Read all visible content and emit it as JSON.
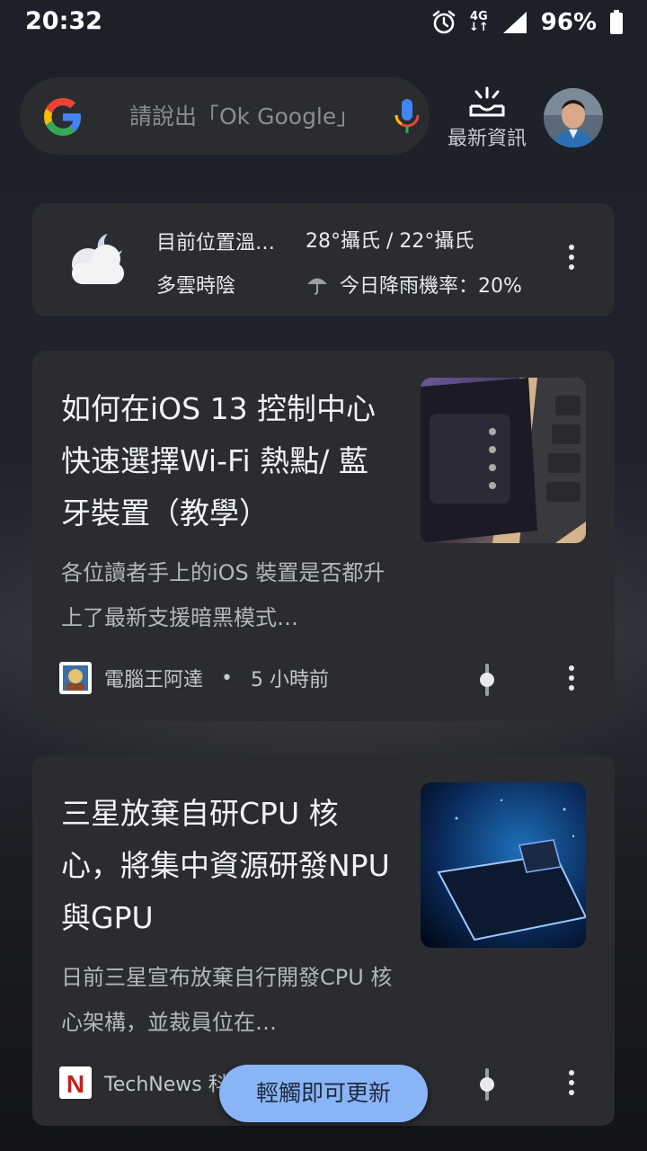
{
  "status_bar": {
    "time": "20:32",
    "network": "4G",
    "battery_percent": "96%"
  },
  "search": {
    "placeholder": "請說出「Ok Google」",
    "icon": "google-g-icon",
    "mic_icon": "mic-icon"
  },
  "news_button": {
    "label": "最新資訊",
    "icon": "inbox-news-icon"
  },
  "weather": {
    "location": "目前位置溫…",
    "condition": "多雲時陰",
    "temperature": "28°攝氏 / 22°攝氏",
    "rain_chance": "今日降雨機率：20%",
    "icon": "cloudy-night-icon",
    "rain_icon": "umbrella-icon"
  },
  "articles": [
    {
      "title": "如何在iOS 13 控制中心快速選擇Wi-Fi 熱點/ 藍牙裝置（教學）",
      "snippet": "各位讀者手上的iOS 裝置是否都升上了最新支援暗黑模式…",
      "source": "電腦王阿達",
      "time": "5 小時前",
      "separator": "•"
    },
    {
      "title": "三星放棄自研CPU 核心，將集中資源研發NPU 與GPU",
      "snippet": "日前三星宣布放棄自行開發CPU 核心架構，並裁員位在…",
      "source": "TechNews 科",
      "source_logo_letter": "N"
    }
  ],
  "refresh_button": {
    "label": "輕觸即可更新"
  },
  "colors": {
    "card_bg": "#2b2c30",
    "accent": "#8ab4f8"
  }
}
